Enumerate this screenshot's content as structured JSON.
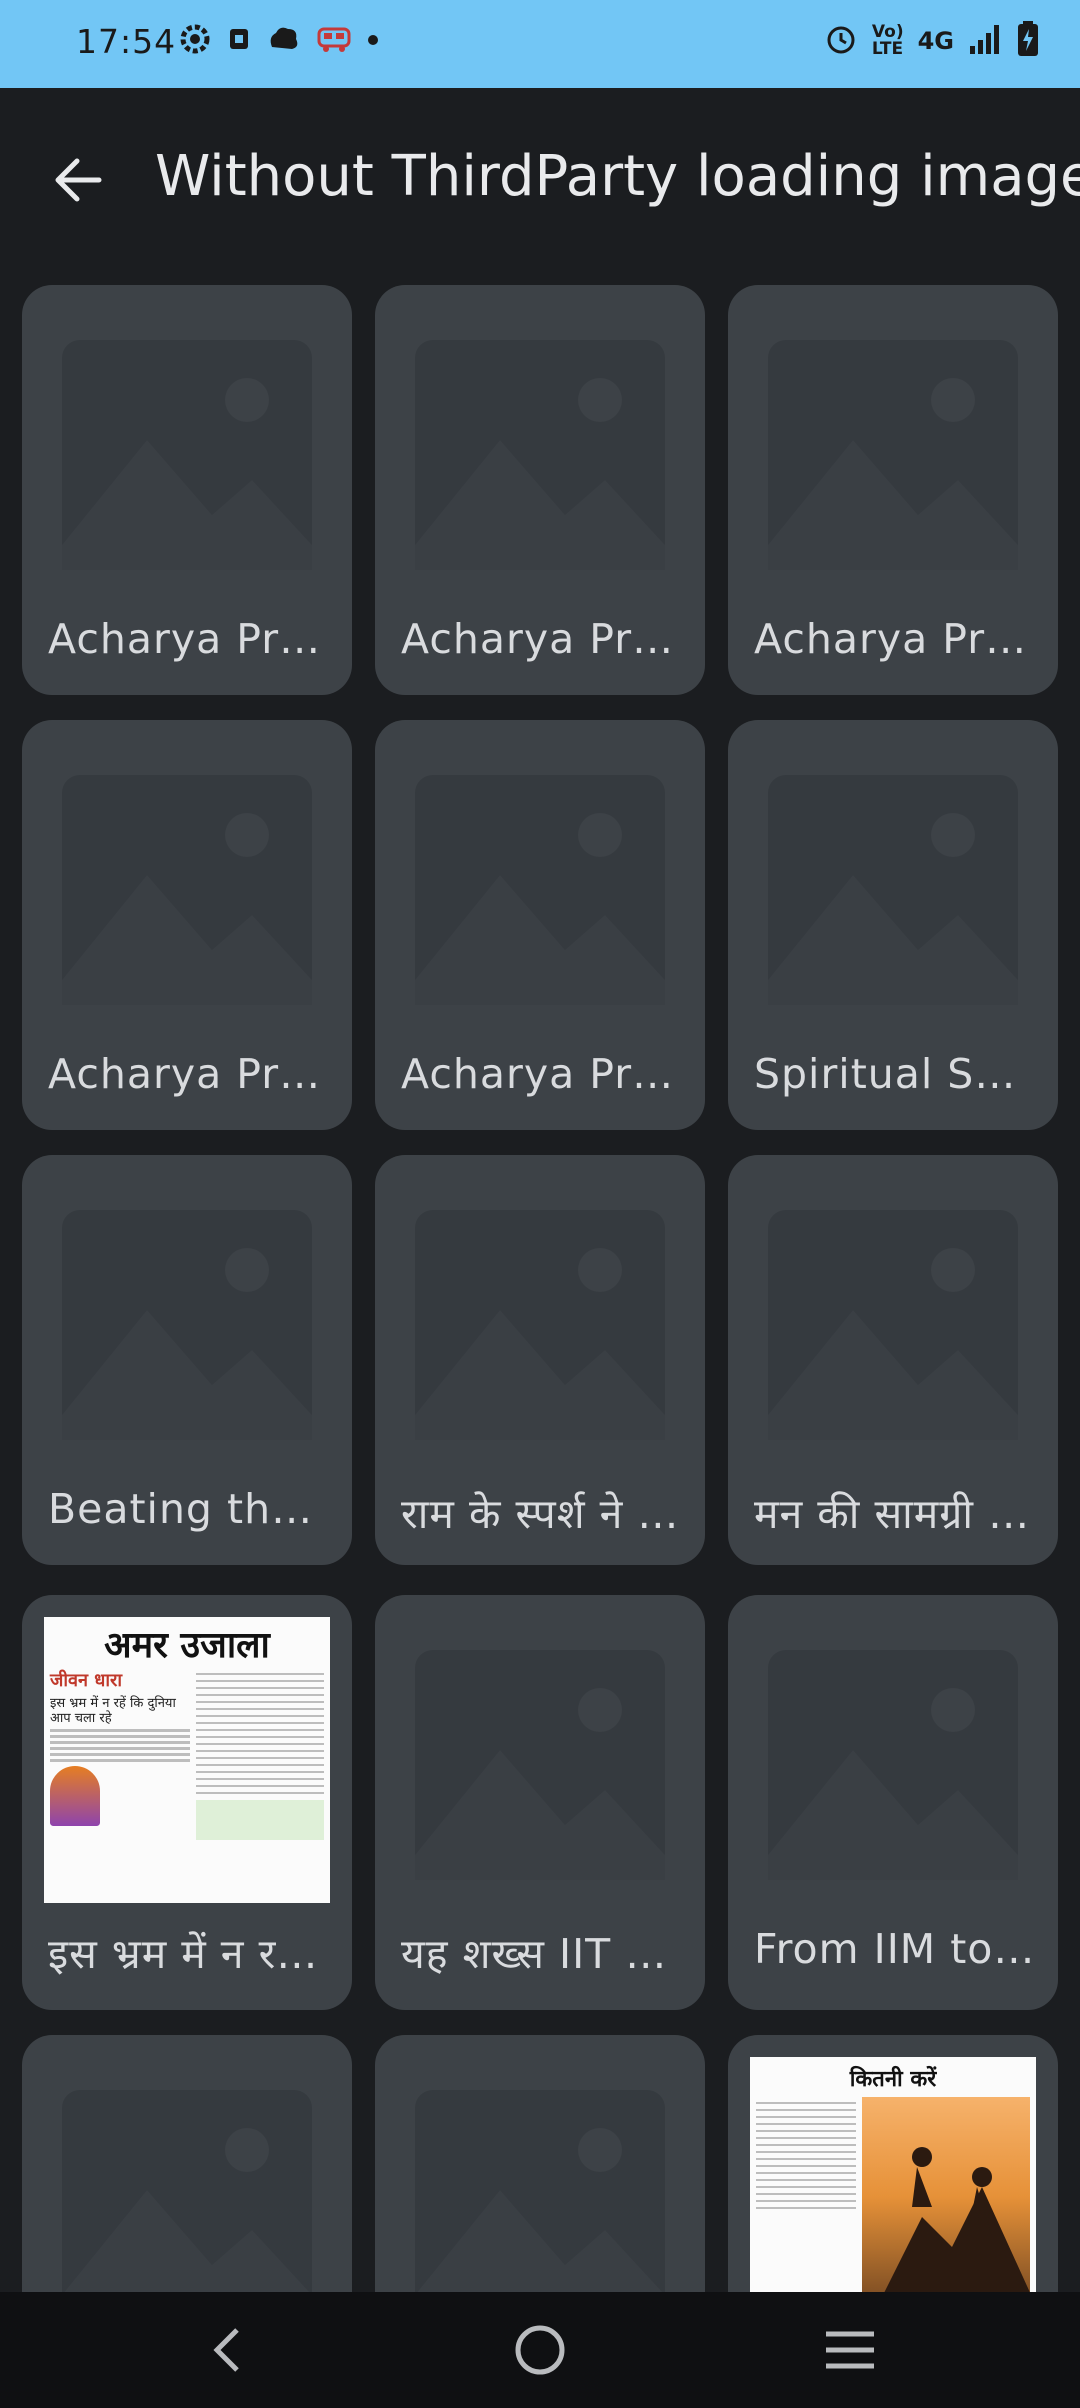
{
  "status_bar": {
    "time": "17:54",
    "left_icons": [
      "settings-icon",
      "sim-icon",
      "cloud-icon",
      "bus-icon",
      "dot-icon"
    ],
    "network_label": "4G",
    "volte_label": "Vo)\nLTE",
    "right_icons": [
      "alarm-icon",
      "signal-icon",
      "battery-charging-icon"
    ]
  },
  "app_bar": {
    "back_icon": "arrow-back-icon",
    "title": "Without ThirdParty loading image"
  },
  "grid": {
    "items": [
      {
        "label": "Acharya Pra…",
        "thumb": "placeholder"
      },
      {
        "label": "Acharya Pra…",
        "thumb": "placeholder"
      },
      {
        "label": "Acharya Pra…",
        "thumb": "placeholder"
      },
      {
        "label": "Acharya Pra…",
        "thumb": "placeholder"
      },
      {
        "label": "Acharya Pra…",
        "thumb": "placeholder"
      },
      {
        "label": "Spiritual Sol…",
        "thumb": "placeholder"
      },
      {
        "label": "Beating the …",
        "thumb": "placeholder"
      },
      {
        "label": "राम के स्पर्श ने …",
        "thumb": "placeholder"
      },
      {
        "label": "मन की सामग्री …",
        "thumb": "placeholder"
      },
      {
        "label": "इस भ्रम में न रहें…",
        "thumb": "newspaper",
        "newspaper_title": "अमर उजाला",
        "headline": "इस भ्रम में न रहें कि दुनिया आप चला रहे",
        "section": "जीवन धारा"
      },
      {
        "label": "यह शख्स IIT &…",
        "thumb": "placeholder"
      },
      {
        "label": "From IIM to …",
        "thumb": "placeholder"
      },
      {
        "label": "",
        "thumb": "placeholder"
      },
      {
        "label": "",
        "thumb": "placeholder"
      },
      {
        "label": "",
        "thumb": "photo-article",
        "headline": "कितनी करें"
      }
    ]
  },
  "nav_bar": {
    "back": "nav-back-icon",
    "home": "nav-home-icon",
    "recents": "nav-menu-icon"
  }
}
